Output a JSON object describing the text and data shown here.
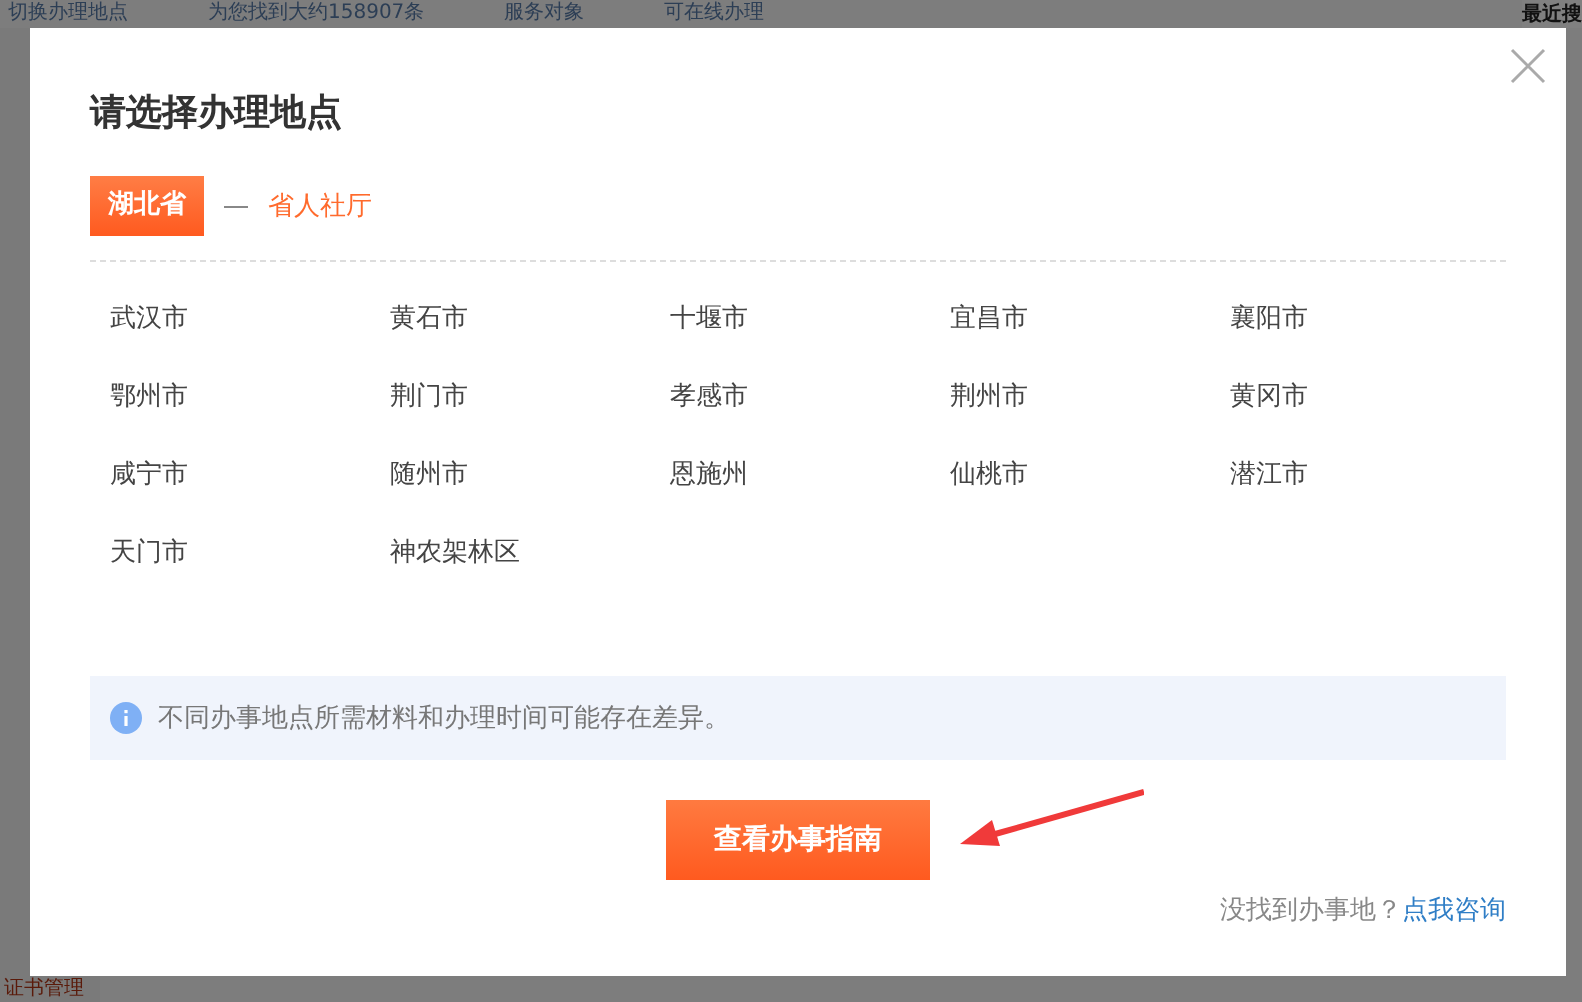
{
  "background": {
    "top_bar": [
      "切换办理地点",
      "为您找到大约158907条",
      "服务对象",
      "可在线办理"
    ],
    "side_heading": "最近搜",
    "bottom_text": "证书管理"
  },
  "dialog": {
    "title": "请选择办理地点",
    "province": {
      "label": "湖北省",
      "selected": true
    },
    "department": "省人社厅",
    "cities": [
      "武汉市",
      "黄石市",
      "十堰市",
      "宜昌市",
      "襄阳市",
      "鄂州市",
      "荆门市",
      "孝感市",
      "荆州市",
      "黄冈市",
      "咸宁市",
      "随州市",
      "恩施州",
      "仙桃市",
      "潜江市",
      "天门市",
      "神农架林区"
    ],
    "notice": "不同办事地点所需材料和办理时间可能存在差异。",
    "primary_button": "查看办事指南",
    "help_text": "没找到办事地？",
    "help_link": "点我咨询"
  }
}
